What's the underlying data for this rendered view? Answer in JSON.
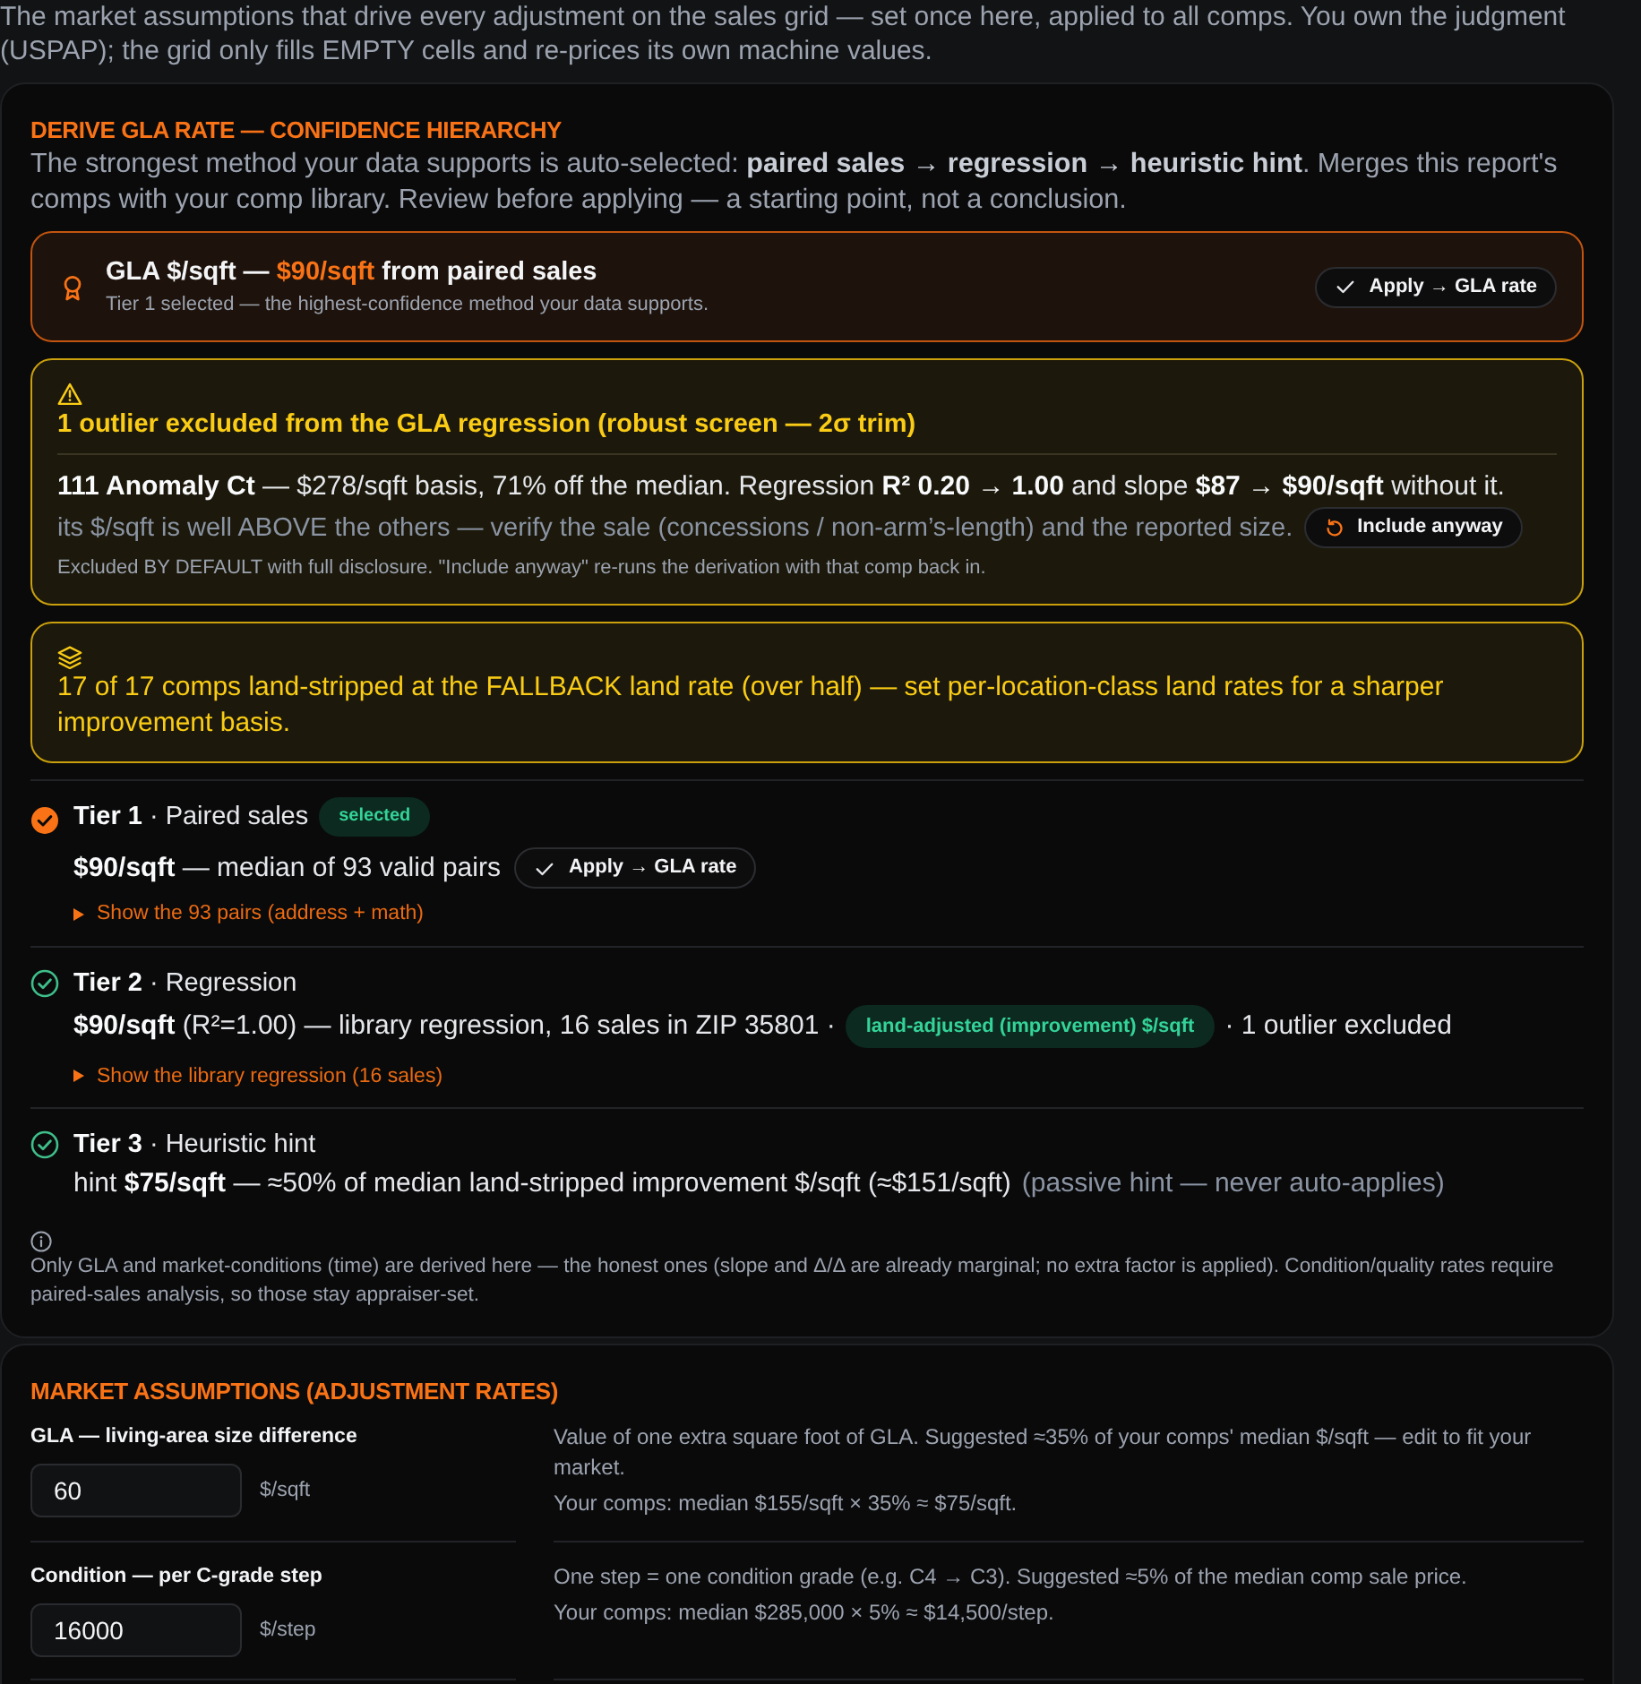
{
  "intro": {
    "text": "The market assumptions that drive every adjustment on the sales grid — set once here, applied to all comps. You own the judgment (USPAP); the grid only fills EMPTY cells and re-prices its own machine values."
  },
  "derive_panel": {
    "title": "DERIVE GLA RATE — CONFIDENCE HIERARCHY",
    "description": "The strongest method your data supports is auto-selected: **paired sales → regression → heuristic hint**. Merges this report's comps with your comp library. Review before applying — a starting point, not a conclusion.",
    "recommendation": {
      "title": "GLA $/sqft —",
      "highlight": "$90/sqft",
      "title_end": "from paired sales",
      "subtitle": "Tier 1 selected — the highest-confidence method your data supports.",
      "button": "Apply → GLA rate"
    },
    "outlier_notice": {
      "title": "1 outlier excluded from the GLA regression (robust screen — 2σ trim)",
      "body": "**111 Anomaly Ct** — $278/sqft basis, 71% off the median. Regression **R² 0.20 → 1.00** and slope **$87 → $90/sqft** without it.",
      "note": "its $/sqft is well ABOVE the others — verify the sale (concessions / non-arm’s-length) and the reported size.",
      "button": "Include anyway",
      "footnote": "Excluded BY DEFAULT with full disclosure. \"Include anyway\" re-runs the derivation with that comp back in."
    },
    "land_notice": {
      "text": "17 of 17 comps land-stripped at the FALLBACK land rate (over half) — set per-location-class land rates for a sharper improvement basis."
    },
    "tiers": [
      {
        "heading": "**Tier 1** · Paired sales",
        "selected": true,
        "badge": "selected",
        "detail": [
          {
            "kind": "text",
            "text": "**$90/sqft** — median of 93 valid pairs"
          },
          {
            "kind": "button",
            "text": "Apply → GLA rate"
          }
        ],
        "disclosure": {
          "label": "Show the 93 pairs (address + math)",
          "expanded": false
        }
      },
      {
        "heading": "**Tier 2** · Regression",
        "selected": false,
        "detail": [
          {
            "kind": "text",
            "text": "**$90/sqft** (R²=1.00) — library regression, 16 sales in ZIP 35801 ·"
          },
          {
            "kind": "badge",
            "text": "land-adjusted (improvement) $/sqft"
          },
          {
            "kind": "text",
            "text": "· 1 outlier excluded"
          }
        ],
        "disclosure": {
          "label": "Show the library regression (16 sales)",
          "expanded": false
        }
      },
      {
        "heading": "**Tier 3** · Heuristic hint",
        "selected": false,
        "detail": [
          {
            "kind": "text",
            "text": "hint **$75/sqft** — ≈50% of median land-stripped improvement $/sqft (≈$151/sqft)"
          },
          {
            "kind": "muted",
            "text": "(passive hint — never auto-applies)"
          }
        ]
      }
    ],
    "footnote": "Only GLA and market-conditions (time) are derived here — the honest ones (slope and Δ/Δ are already marginal; no extra factor is applied). Condition/quality rates require paired-sales analysis, so those stay appraiser-set."
  },
  "market_assumptions": {
    "title": "MARKET ASSUMPTIONS (ADJUSTMENT RATES)",
    "rows": [
      {
        "label": "GLA — living-area size difference",
        "value": "60",
        "unit": "$/sqft",
        "notes": [
          "Value of one extra square foot of GLA. Suggested ≈35% of your comps' median $/sqft — edit to fit your market.",
          "Your comps: median $155/sqft × 35% ≈ $75/sqft."
        ]
      },
      {
        "label": "Condition — per C-grade step",
        "value": "16000",
        "unit": "$/step",
        "notes": [
          "One step = one condition grade (e.g. C4 → C3). Suggested ≈5% of the median comp sale price.",
          "Your comps: median $285,000 × 5% ≈ $14,500/step."
        ]
      }
    ]
  }
}
